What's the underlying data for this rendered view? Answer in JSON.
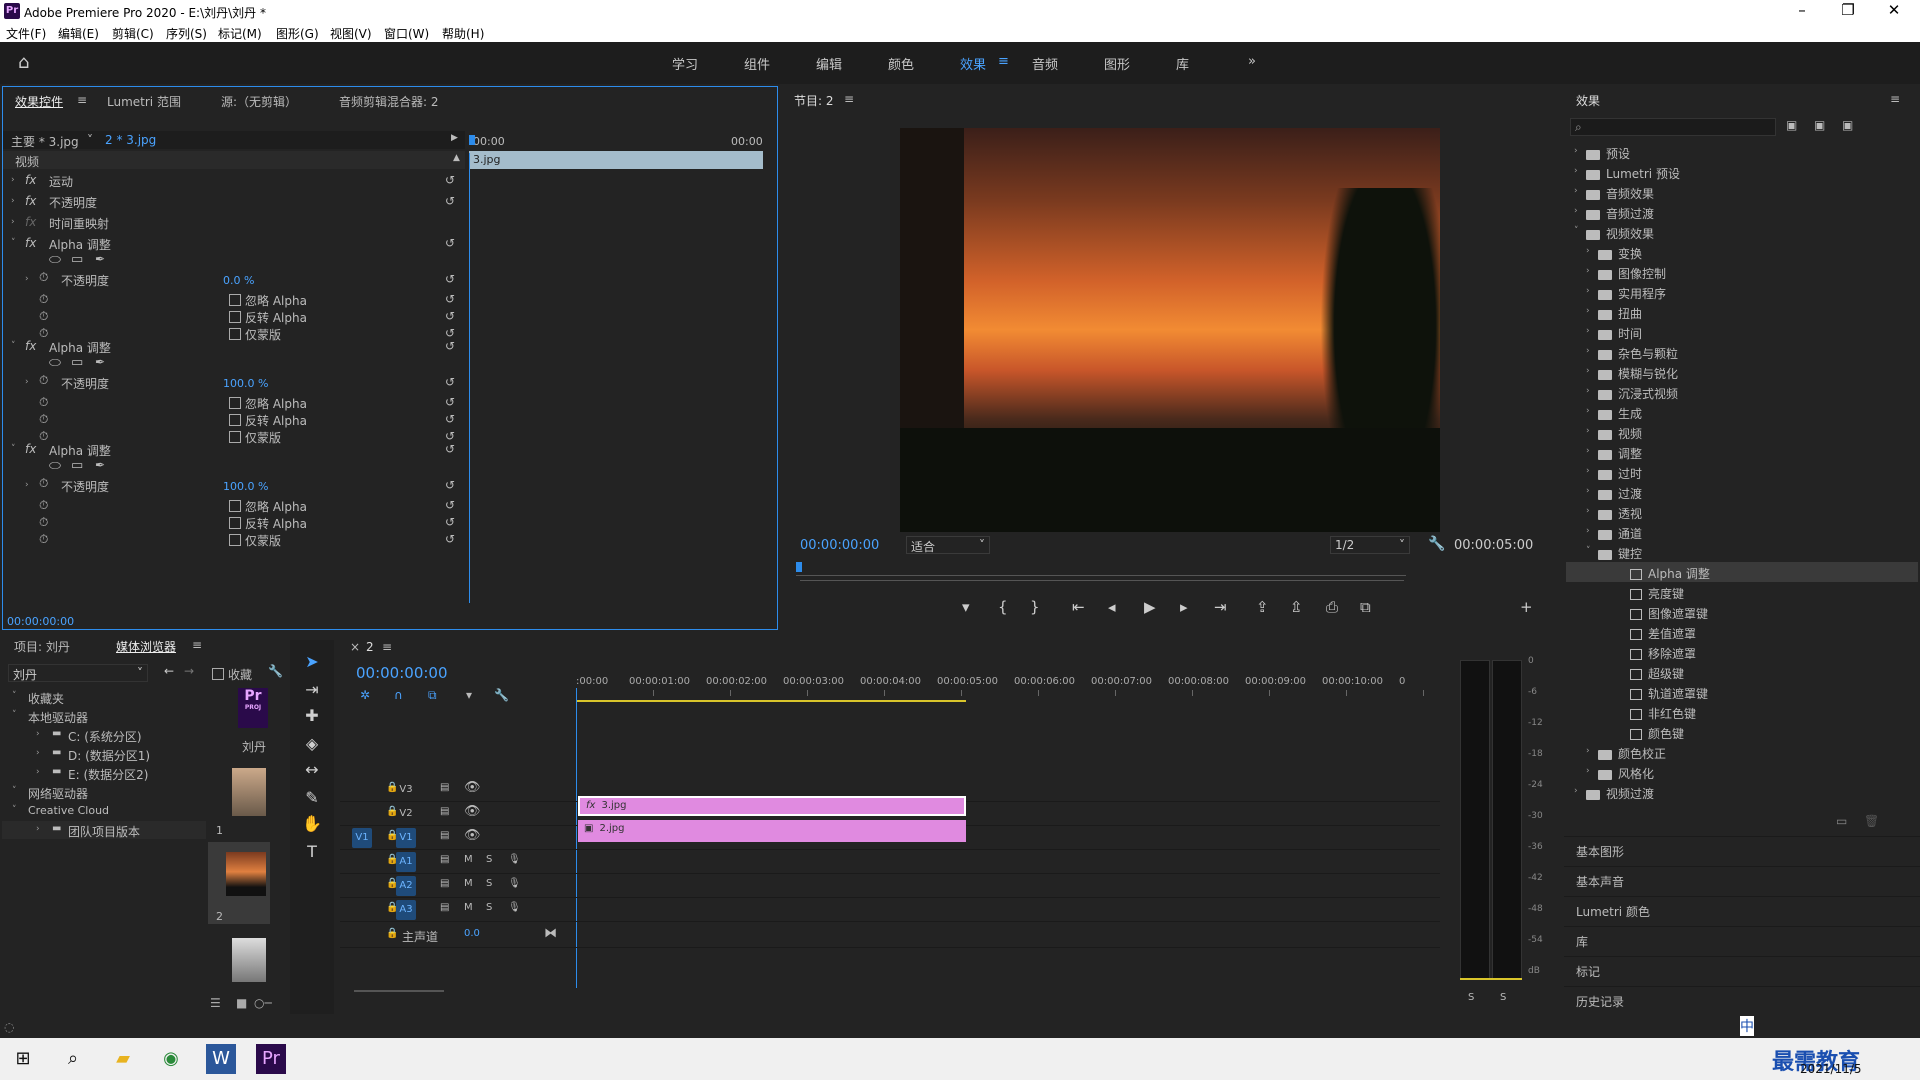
{
  "app": {
    "title": "Adobe Premiere Pro 2020 - E:\\刘丹\\刘丹 *",
    "logo": "Pr"
  },
  "menu": [
    "文件(F)",
    "编辑(E)",
    "剪辑(C)",
    "序列(S)",
    "标记(M)",
    "图形(G)",
    "视图(V)",
    "窗口(W)",
    "帮助(H)"
  ],
  "workspaces": [
    "学习",
    "组件",
    "编辑",
    "颜色",
    "效果",
    "音频",
    "图形",
    "库"
  ],
  "effect_controls": {
    "tabs": [
      "效果控件",
      "Lumetri 范围",
      "源:（无剪辑）",
      "音频剪辑混合器: 2"
    ],
    "master": "主要 * 3.jpg",
    "clip": "2 * 3.jpg",
    "time_start": "00:00",
    "time_end": "00:00",
    "clip_bar": "3.jpg",
    "section": "视频",
    "rows": [
      "运动",
      "不透明度",
      "时间重映射"
    ],
    "alpha_title": "Alpha 调整",
    "opacity_label": "不透明度",
    "alpha_values": [
      "0.0 %",
      "100.0 %",
      "100.0 %"
    ],
    "checks": [
      "忽略 Alpha",
      "反转 Alpha",
      "仅蒙版"
    ],
    "timecode": "00:00:00:00"
  },
  "program": {
    "title": "节目: 2",
    "timecode": "00:00:00:00",
    "fit": "适合",
    "quality": "1/2",
    "duration": "00:00:05:00"
  },
  "effects_panel": {
    "title": "效果",
    "items": [
      {
        "label": "预设",
        "level": 0,
        "open": false
      },
      {
        "label": "Lumetri 预设",
        "level": 0,
        "open": false
      },
      {
        "label": "音频效果",
        "level": 0,
        "open": false
      },
      {
        "label": "音频过渡",
        "level": 0,
        "open": false
      },
      {
        "label": "视频效果",
        "level": 0,
        "open": true
      },
      {
        "label": "变换",
        "level": 1,
        "open": false
      },
      {
        "label": "图像控制",
        "level": 1,
        "open": false
      },
      {
        "label": "实用程序",
        "level": 1,
        "open": false
      },
      {
        "label": "扭曲",
        "level": 1,
        "open": false
      },
      {
        "label": "时间",
        "level": 1,
        "open": false
      },
      {
        "label": "杂色与颗粒",
        "level": 1,
        "open": false
      },
      {
        "label": "模糊与锐化",
        "level": 1,
        "open": false
      },
      {
        "label": "沉浸式视频",
        "level": 1,
        "open": false
      },
      {
        "label": "生成",
        "level": 1,
        "open": false
      },
      {
        "label": "视频",
        "level": 1,
        "open": false
      },
      {
        "label": "调整",
        "level": 1,
        "open": false
      },
      {
        "label": "过时",
        "level": 1,
        "open": false
      },
      {
        "label": "过渡",
        "level": 1,
        "open": false
      },
      {
        "label": "透视",
        "level": 1,
        "open": false
      },
      {
        "label": "通道",
        "level": 1,
        "open": false
      },
      {
        "label": "键控",
        "level": 1,
        "open": true
      },
      {
        "label": "Alpha 调整",
        "level": 2,
        "selected": true
      },
      {
        "label": "亮度键",
        "level": 2
      },
      {
        "label": "图像遮罩键",
        "level": 2
      },
      {
        "label": "差值遮罩",
        "level": 2
      },
      {
        "label": "移除遮罩",
        "level": 2
      },
      {
        "label": "超级键",
        "level": 2
      },
      {
        "label": "轨道遮罩键",
        "level": 2
      },
      {
        "label": "非红色键",
        "level": 2
      },
      {
        "label": "颜色键",
        "level": 2
      },
      {
        "label": "颜色校正",
        "level": 1,
        "open": false
      },
      {
        "label": "风格化",
        "level": 1,
        "open": false
      },
      {
        "label": "视频过渡",
        "level": 0,
        "open": false
      }
    ],
    "bottom_panels": [
      "基本图形",
      "基本声音",
      "Lumetri 颜色",
      "库",
      "标记",
      "历史记录"
    ]
  },
  "project": {
    "tabs": [
      "项目: 刘丹",
      "媒体浏览器"
    ],
    "location": "刘丹",
    "favorites_label": "收藏",
    "tree": [
      {
        "label": "收藏夹",
        "level": 0
      },
      {
        "label": "本地驱动器",
        "level": 0
      },
      {
        "label": "C: (系统分区)",
        "level": 1
      },
      {
        "label": "D: (数据分区1)",
        "level": 1
      },
      {
        "label": "E: (数据分区2)",
        "level": 1
      },
      {
        "label": "网络驱动器",
        "level": 0
      },
      {
        "label": "Creative Cloud",
        "level": 0
      },
      {
        "label": "团队项目版本",
        "level": 1
      }
    ],
    "thumb_name": "刘丹",
    "thumb_nums": [
      "1",
      "2"
    ]
  },
  "timeline": {
    "tab": "2",
    "timecode": "00:00:00:00",
    "ruler": [
      ":00:00",
      "00:00:01:00",
      "00:00:02:00",
      "00:00:03:00",
      "00:00:04:00",
      "00:00:05:00",
      "00:00:06:00",
      "00:00:07:00",
      "00:00:08:00",
      "00:00:09:00",
      "00:00:10:00",
      "0"
    ],
    "video_tracks": [
      "V3",
      "V2",
      "V1"
    ],
    "audio_tracks": [
      "A1",
      "A2",
      "A3"
    ],
    "source_v": "V1",
    "master": "主声道",
    "master_value": "0.0",
    "clip_v2": "3.jpg",
    "clip_v1": "2.jpg",
    "track_letters": [
      "M",
      "S"
    ]
  },
  "meter": {
    "scale": [
      "0",
      "-6",
      "-12",
      "-18",
      "-24",
      "-30",
      "-36",
      "-42",
      "-48",
      "-54",
      "dB"
    ],
    "solo": [
      "S",
      "S"
    ]
  },
  "taskbar": {
    "date": "2021/11/5",
    "watermark": "最需教育",
    "ime": "中"
  },
  "colors": {
    "accent": "#2d8ceb",
    "clip": "#e08ae0",
    "sky": "#e8762a"
  }
}
